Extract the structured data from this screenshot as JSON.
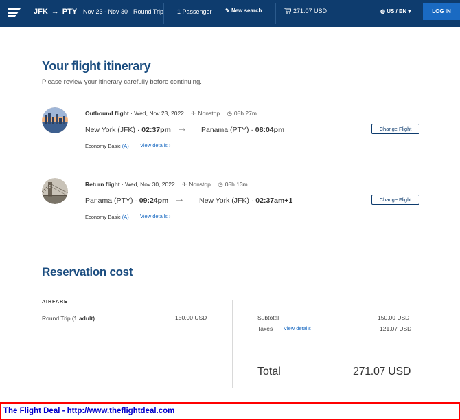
{
  "header": {
    "origin": "JFK",
    "destination": "PTY",
    "dates": "Nov 23 - Nov 30 · Round Trip",
    "passengers": "1 Passenger",
    "new_search": "New search",
    "cart_total": "271.07 USD",
    "locale": "US / EN",
    "login": "LOG IN"
  },
  "itinerary": {
    "title": "Your flight itinerary",
    "subtitle": "Please review your itinerary carefully before continuing.",
    "flights": [
      {
        "label": "Outbound flight",
        "date": "Wed, Nov 23, 2022",
        "stops": "Nonstop",
        "duration": "05h 27m",
        "origin": "New York (JFK)",
        "depart_time": "02:37pm",
        "destination": "Panama (PTY)",
        "arrive_time": "08:04pm",
        "cabin": "Economy Basic",
        "fare_code": "(A)",
        "details_link": "View details",
        "change_button": "Change Flight"
      },
      {
        "label": "Return flight",
        "date": "Wed, Nov 30, 2022",
        "stops": "Nonstop",
        "duration": "05h 13m",
        "origin": "Panama (PTY)",
        "depart_time": "09:24pm",
        "destination": "New York (JFK)",
        "arrive_time": "02:37am+1",
        "cabin": "Economy Basic",
        "fare_code": "(A)",
        "details_link": "View details",
        "change_button": "Change Flight"
      }
    ]
  },
  "cost": {
    "title": "Reservation cost",
    "airfare_label": "AIRFARE",
    "trip_type": "Round Trip",
    "travelers": "(1 adult)",
    "airfare_amount": "150.00 USD",
    "subtotal_label": "Subtotal",
    "subtotal": "150.00 USD",
    "taxes_label": "Taxes",
    "taxes_link": "View details",
    "taxes": "121.07 USD",
    "total_label": "Total",
    "total": "271.07 USD"
  },
  "footer": {
    "text": "The Flight Deal - http://www.theflightdeal.com"
  },
  "colors": {
    "header_bg": "#0e3c6e",
    "accent": "#1a6ac2",
    "title": "#1b4d80",
    "footer_border": "#ff0000",
    "footer_text": "#0000cc"
  }
}
